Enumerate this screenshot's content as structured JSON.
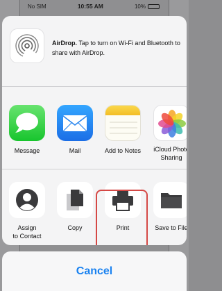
{
  "status_bar": {
    "carrier": "No SIM",
    "time": "10:55 AM",
    "battery": "10%",
    "battery_level": 0.1
  },
  "airdrop": {
    "icon": "airdrop-icon",
    "title": "AirDrop.",
    "description": " Tap to turn on Wi-Fi and Bluetooth to share with AirDrop."
  },
  "apps": [
    {
      "label": "Message",
      "icon": "messages-icon",
      "color": "#3ed552"
    },
    {
      "label": "Mail",
      "icon": "mail-icon",
      "color": "#2a8ff3"
    },
    {
      "label": "Add to Notes",
      "icon": "notes-icon",
      "color": "#f7cb35"
    },
    {
      "label": "iCloud Photo\nSharing",
      "icon": "photos-icon",
      "color": "#ffffff"
    }
  ],
  "actions": [
    {
      "label": "Assign\nto Contact",
      "icon": "contact-icon"
    },
    {
      "label": "Copy",
      "icon": "copy-icon"
    },
    {
      "label": "Print",
      "icon": "print-icon",
      "highlight_color": "#d54845"
    },
    {
      "label": "Save to File",
      "icon": "folder-icon"
    }
  ],
  "cancel": {
    "label": "Cancel",
    "color": "#1a82f0"
  }
}
